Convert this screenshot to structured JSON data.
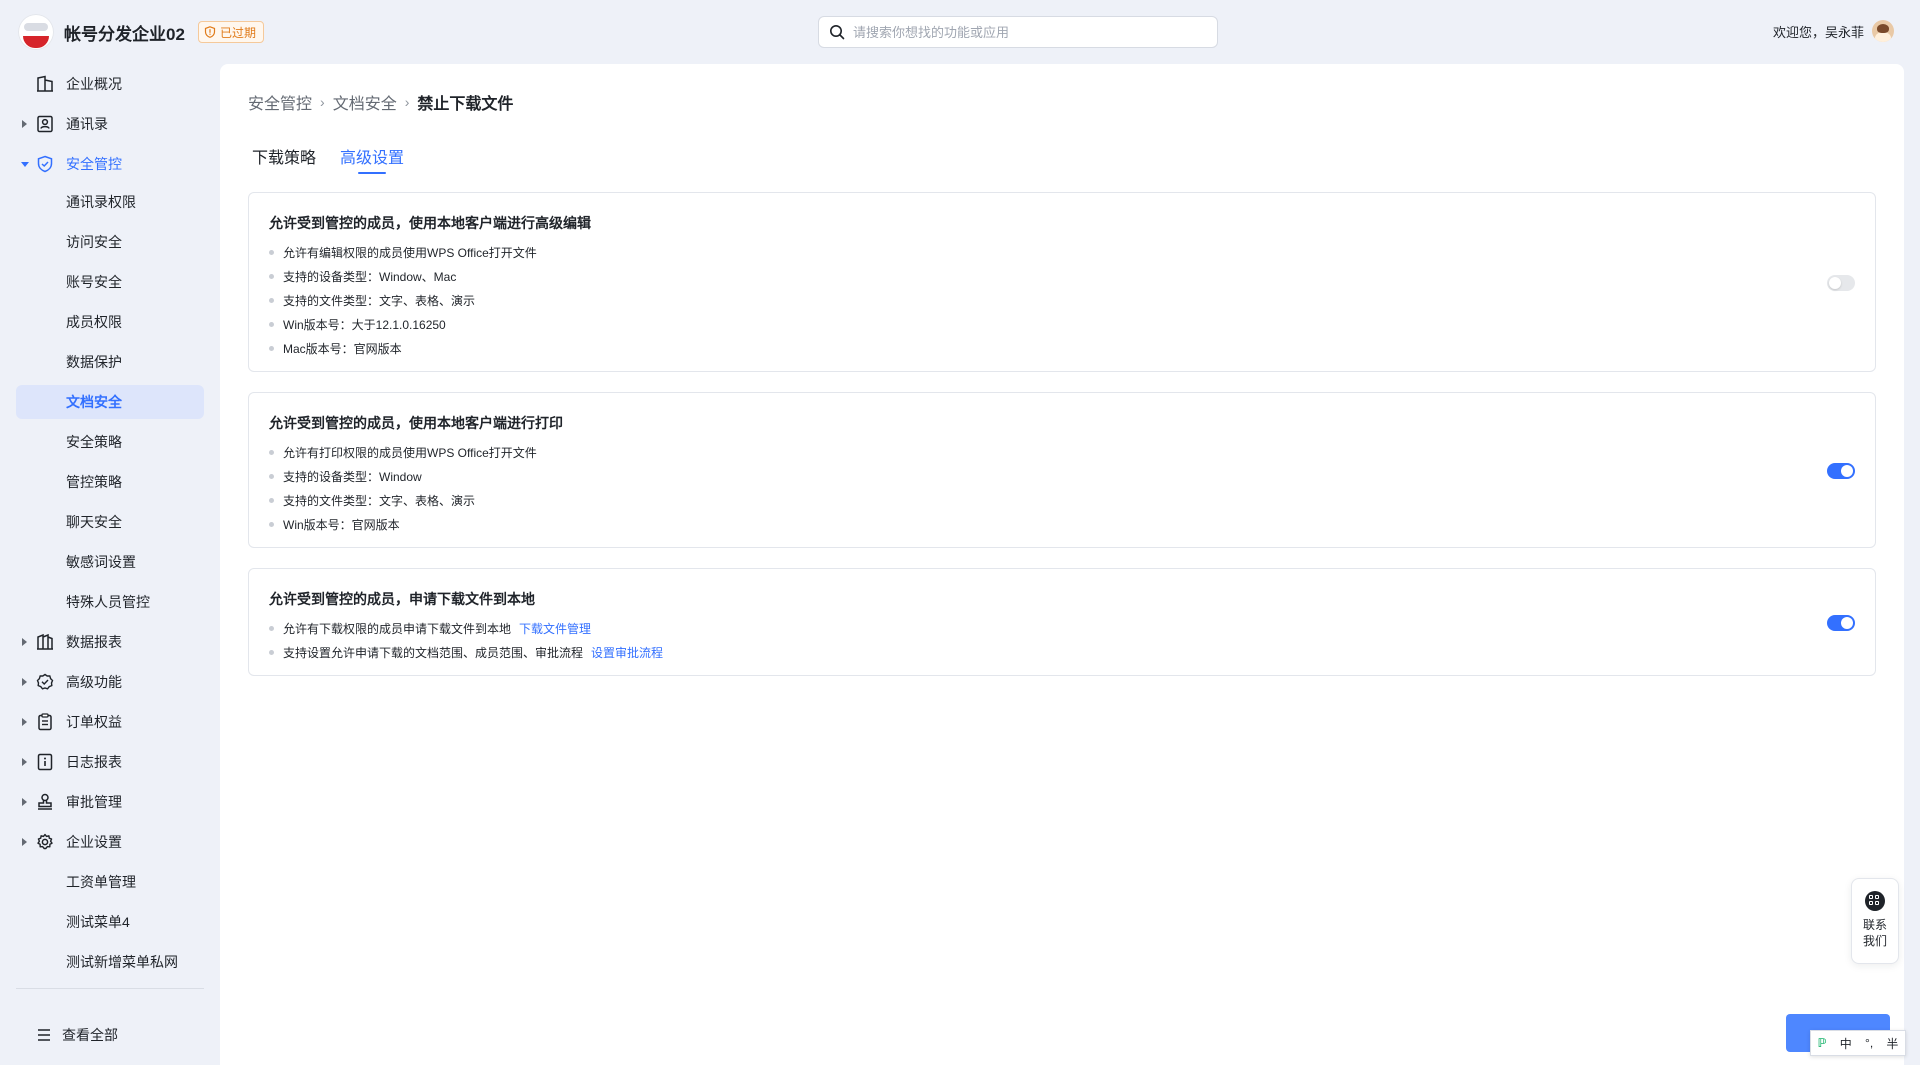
{
  "header": {
    "org_name": "帐号分发企业02",
    "badge": "已过期",
    "search_placeholder": "请搜索你想找的功能或应用",
    "welcome": "欢迎您，吴永菲"
  },
  "sidebar": {
    "items": [
      {
        "label": "企业概况"
      },
      {
        "label": "通讯录"
      },
      {
        "label": "安全管控"
      },
      {
        "label": "通讯录权限"
      },
      {
        "label": "访问安全"
      },
      {
        "label": "账号安全"
      },
      {
        "label": "成员权限"
      },
      {
        "label": "数据保护"
      },
      {
        "label": "文档安全"
      },
      {
        "label": "安全策略"
      },
      {
        "label": "管控策略"
      },
      {
        "label": "聊天安全"
      },
      {
        "label": "敏感词设置"
      },
      {
        "label": "特殊人员管控"
      },
      {
        "label": "数据报表"
      },
      {
        "label": "高级功能"
      },
      {
        "label": "订单权益"
      },
      {
        "label": "日志报表"
      },
      {
        "label": "审批管理"
      },
      {
        "label": "企业设置"
      },
      {
        "label": "工资单管理"
      },
      {
        "label": "测试菜单4"
      },
      {
        "label": "测试新增菜单私网"
      }
    ],
    "view_all": "查看全部"
  },
  "breadcrumb": [
    "安全管控",
    "文档安全",
    "禁止下载文件"
  ],
  "tabs": [
    "下载策略",
    "高级设置"
  ],
  "active_tab": "高级设置",
  "cards": [
    {
      "title": "允许受到管控的成员，使用本地客户端进行高级编辑",
      "items": [
        "允许有编辑权限的成员使用WPS Office打开文件",
        "支持的设备类型：Window、Mac",
        "支持的文件类型：文字、表格、演示",
        "Win版本号：大于12.1.0.16250",
        "Mac版本号：官网版本"
      ],
      "enabled": false
    },
    {
      "title": "允许受到管控的成员，使用本地客户端进行打印",
      "items": [
        "允许有打印权限的成员使用WPS Office打开文件",
        "支持的设备类型：Window",
        "支持的文件类型：文字、表格、演示",
        "Win版本号：官网版本"
      ],
      "enabled": true
    },
    {
      "title": "允许受到管控的成员，申请下载文件到本地",
      "items": [
        "允许有下载权限的成员申请下载文件到本地",
        "支持设置允许申请下载的文档范围、成员范围、审批流程"
      ],
      "links": [
        "下载文件管理",
        "设置审批流程"
      ],
      "enabled": true
    }
  ],
  "float": {
    "contact_label": "联系我们",
    "ime": [
      "中",
      "°,",
      "半"
    ]
  },
  "colors": {
    "accent": "#3370ff",
    "selected_bg": "#dde5fb",
    "page_bg": "#eef1f8",
    "badge": "#e07b1a"
  }
}
